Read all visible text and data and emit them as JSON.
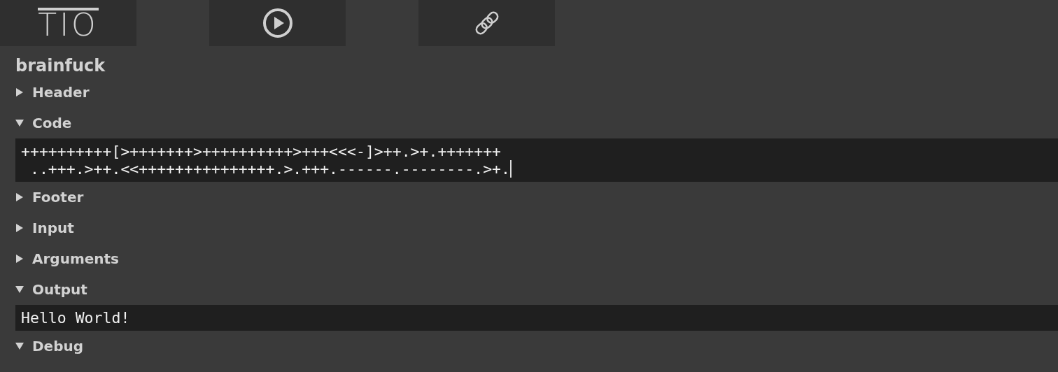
{
  "toolbar": {
    "logo": "TIO"
  },
  "language": "brainfuck",
  "sections": [
    {
      "label": "Header",
      "expanded": false
    },
    {
      "label": "Code",
      "expanded": true,
      "lines": [
        "++++++++++[>+++++++>++++++++++>+++<<<-]>++.>+.+++++++",
        " ..+++.>++.<<+++++++++++++++.>.+++.------.--------.>+."
      ]
    },
    {
      "label": "Footer",
      "expanded": false
    },
    {
      "label": "Input",
      "expanded": false
    },
    {
      "label": "Arguments",
      "expanded": false
    },
    {
      "label": "Output",
      "expanded": true,
      "lines": [
        "Hello World!"
      ]
    },
    {
      "label": "Debug",
      "expanded": true
    }
  ]
}
